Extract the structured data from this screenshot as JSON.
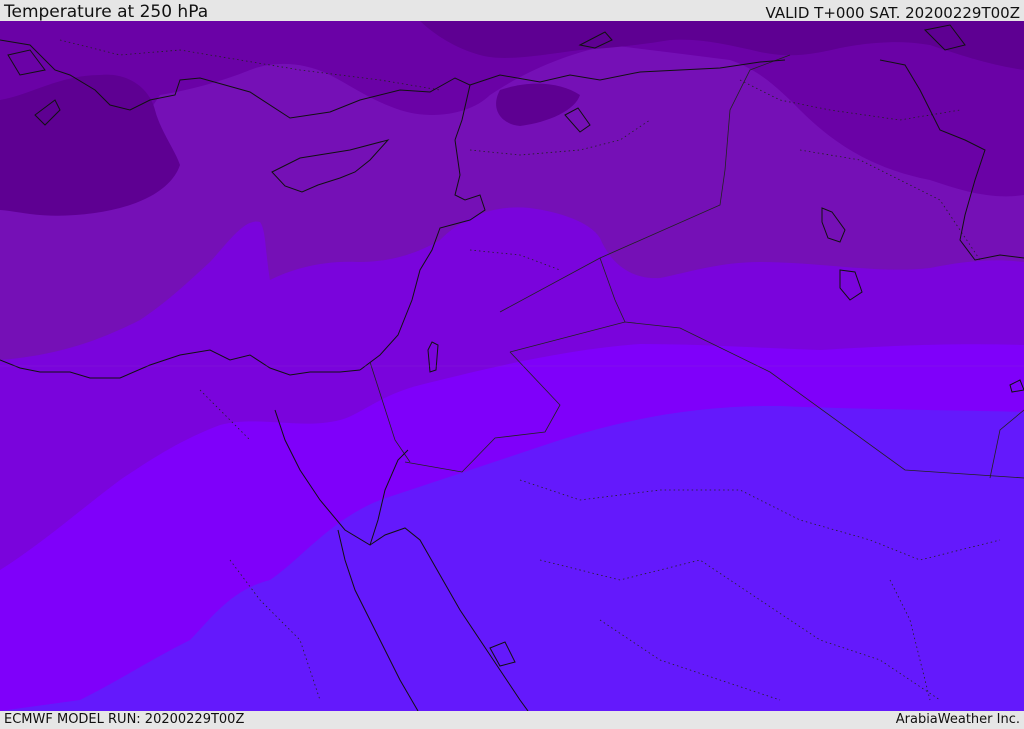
{
  "header": {
    "title": "Temperature at 250 hPa",
    "valid": "VALID T+000 SAT. 20200229T00Z"
  },
  "footer": {
    "model_run": "ECMWF MODEL RUN: 20200229T00Z",
    "provider": "ArabiaWeather Inc."
  },
  "colors": {
    "band_coldest": "#5e0092",
    "band_cold": "#6a02a6",
    "band_cool": "#7510b6",
    "band_mid": "#7a04dc",
    "band_warm": "#7f00fa",
    "band_warmest": "#6419fc",
    "coastline": "#111111",
    "border": "#222222",
    "frame": "#e6e6e6"
  }
}
